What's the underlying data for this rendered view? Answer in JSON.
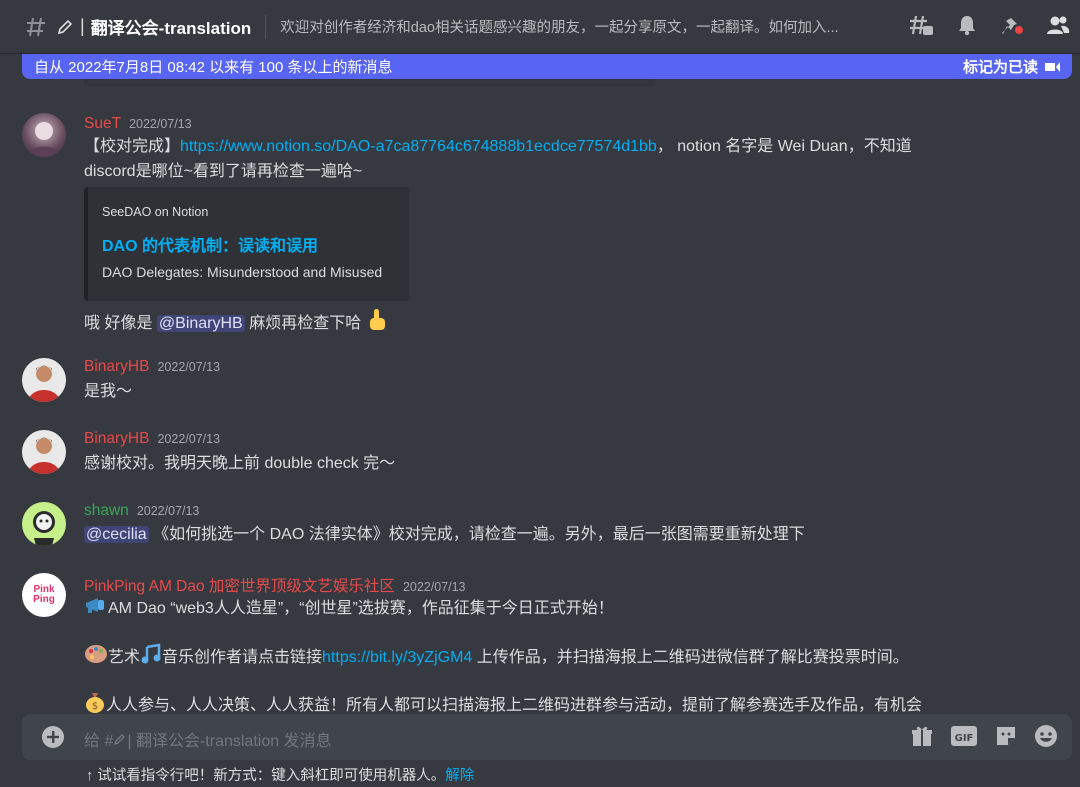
{
  "header": {
    "channel_name": "翻译公会-translation",
    "topic": "欢迎对创作者经济和dao相关话题感兴趣的朋友，一起分享原文，一起翻译。如何加入..."
  },
  "new_messages_bar": {
    "text": "自从 2022年7月8日 08:42 以来有 100 条以上的新消息",
    "mark_read": "标记为已读"
  },
  "messages": [
    {
      "author": "SueT",
      "author_color": "#e84a4a",
      "timestamp": "2022/07/13",
      "line1_prefix": "【校对完成】",
      "link": "https://www.notion.so/DAO-a7ca87764c674888b1ecdce77574d1bb",
      "line1_suffix": "， notion 名字是 Wei Duan，不知道",
      "line2": "discord是哪位~看到了请再检查一遍哈~",
      "embed": {
        "provider": "SeeDAO on Notion",
        "title": "DAO 的代表机制：误读和误用",
        "description": "DAO Delegates: Misunderstood and Misused"
      },
      "followup_prefix": "哦 好像是",
      "followup_mention": "@BinaryHB",
      "followup_suffix": "麻烦再检查下哈"
    },
    {
      "author": "BinaryHB",
      "author_color": "#e84a4a",
      "timestamp": "2022/07/13",
      "text": "是我～"
    },
    {
      "author": "BinaryHB",
      "author_color": "#e84a4a",
      "timestamp": "2022/07/13",
      "text": "感谢校对。我明天晚上前 double check 完～"
    },
    {
      "author": "shawn",
      "author_color": "#3ba55c",
      "timestamp": "2022/07/13",
      "mention": "@cecilia",
      "text": "《如何挑选一个 DAO 法律实体》校对完成，请检查一遍。另外，最后一张图需要重新处理下"
    },
    {
      "author": "PinkPing AM Dao 加密世界顶级文艺娱乐社区",
      "author_color": "#e84a4a",
      "timestamp": "2022/07/13",
      "avatar_text": "Pink Ping",
      "line1": "AM Dao “web3人人造星”，“创世星”选拔赛，作品征集于今日正式开始！",
      "line2_prefix": "艺术",
      "line2_mid": "音乐创作者请点击链接",
      "line2_link": "https://bit.ly/3yZjGM4",
      "line2_suffix": " 上传作品，并扫描海报上二维码进微信群了解比赛投票时间。",
      "line3": "人人参与、人人决策、人人获益！所有人都可以扫描海报上二维码进群参与活动，提前了解参赛选手及作品，有机会"
    }
  ],
  "composer": {
    "placeholder": "给 #",
    "placeholder_channel": "| 翻译公会-translation 发消息"
  },
  "tip": {
    "text": "试试看指令行吧！新方式：键入斜杠即可使用机器人。",
    "dismiss": "解除"
  }
}
